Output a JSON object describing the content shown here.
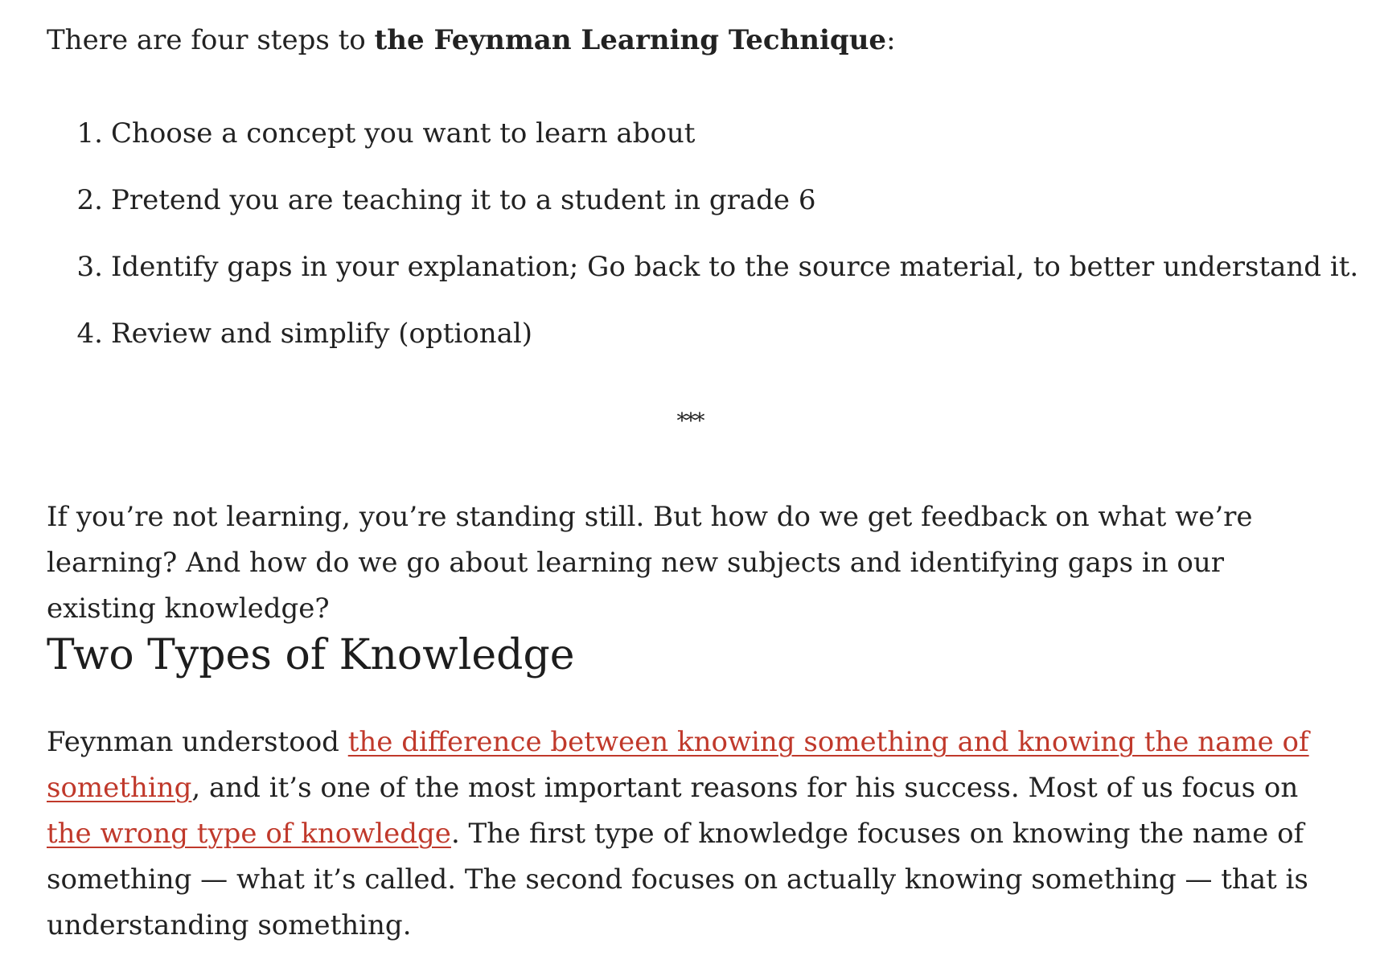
{
  "intro": {
    "lead": "There are four steps to ",
    "bold": "the Feynman Learning Technique",
    "trail": ":"
  },
  "steps": [
    {
      "number": "1.",
      "text": "Choose a concept you want to learn about"
    },
    {
      "number": "2.",
      "text": "Pretend you are teaching it to a student in grade 6"
    },
    {
      "number": "3.",
      "text": "Identify gaps in your explanation;  Go back to the source material, to better understand it."
    },
    {
      "number": "4.",
      "text": "Review and simplify (optional)"
    }
  ],
  "separator": "***",
  "paragraph1": "If you’re not learning, you’re standing still. But how do we get feedback on what we’re learning? And how do we go about learning new subjects and identifying gaps in our existing knowledge?",
  "section": {
    "heading": "Two Types of Knowledge",
    "paragraph": {
      "part1": "Feynman understood ",
      "link1": "the difference between knowing something and knowing the name of something",
      "part2": ", and it’s one of the most important reasons for his success. Most of us focus on ",
      "link2": "the wrong type of knowledge",
      "part3": ". The first type of knowledge focuses on knowing the name of something — what it’s called. The second focuses on actually knowing something — that is understanding something."
    }
  },
  "colors": {
    "text": "#222222",
    "link": "#c0392b",
    "background": "#ffffff"
  }
}
